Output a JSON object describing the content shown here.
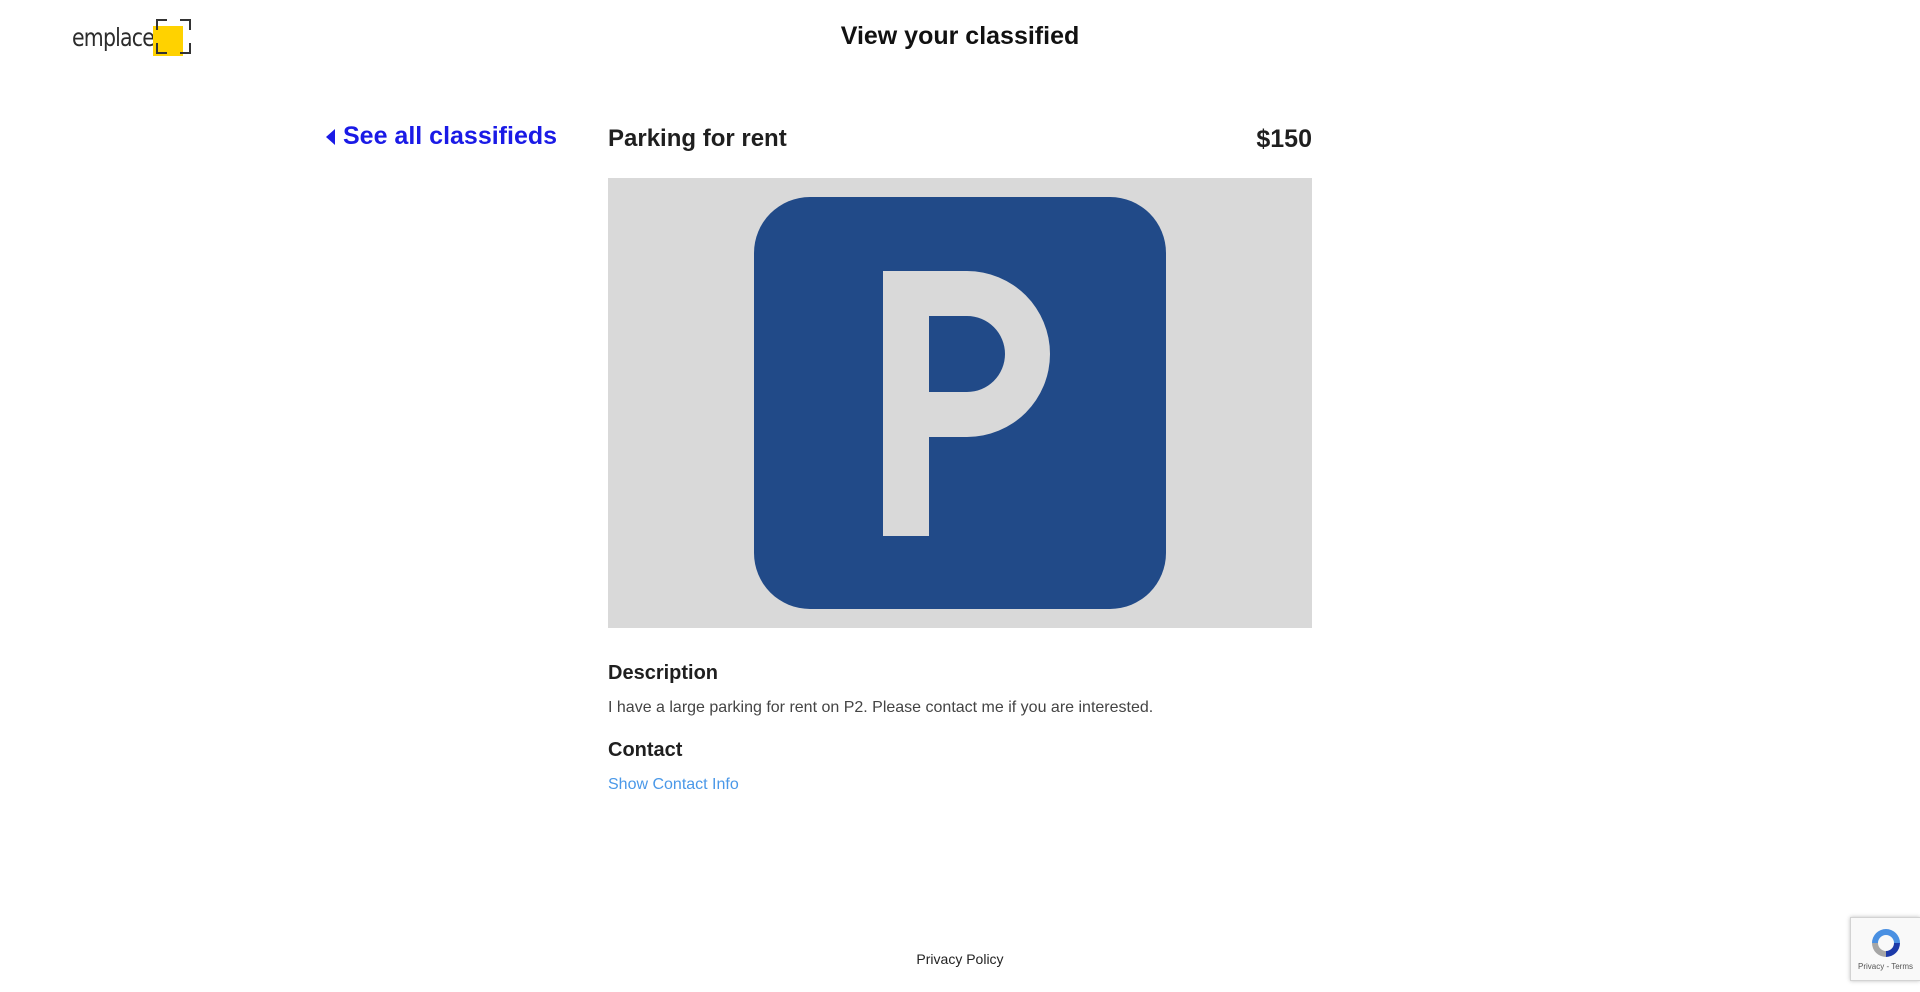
{
  "header": {
    "logo_text": "emplace",
    "page_title": "View your classified"
  },
  "nav": {
    "back_label": "See all classifieds"
  },
  "classified": {
    "title": "Parking for rent",
    "price": "$150",
    "image_label": "P",
    "description_heading": "Description",
    "description": "I have a large parking for rent on P2. Please contact me if you are interested.",
    "contact_heading": "Contact",
    "contact_link": "Show Contact Info"
  },
  "footer": {
    "privacy_label": "Privacy Policy"
  },
  "recaptcha": {
    "links": "Privacy - Terms"
  },
  "colors": {
    "link_blue": "#1a1ae6",
    "contact_link": "#4a98e8",
    "parking_sign": "#214a88",
    "image_background": "#d9d9d9",
    "logo_yellow": "#ffd200"
  },
  "icons": [
    "caret-left-icon",
    "parking-sign-icon",
    "recaptcha-icon"
  ]
}
